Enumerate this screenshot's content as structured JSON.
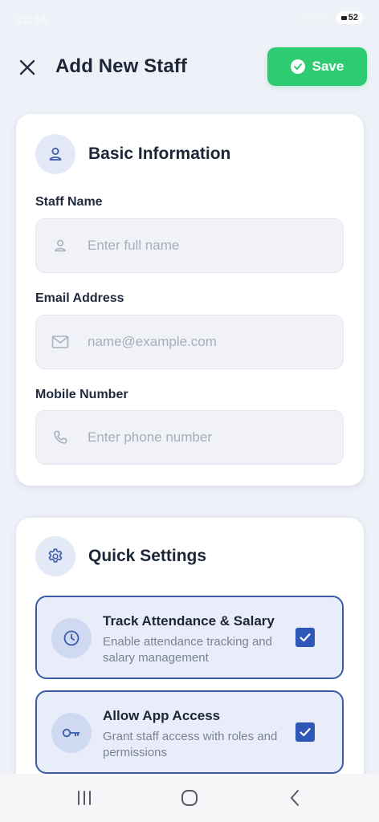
{
  "status_bar": {
    "time": "22:16",
    "signal": "Vo LTE",
    "battery": "52"
  },
  "header": {
    "title": "Add New Staff",
    "save_label": "Save"
  },
  "basic_info": {
    "title": "Basic Information",
    "fields": [
      {
        "label": "Staff Name",
        "placeholder": "Enter full name",
        "value": "",
        "icon": "user-icon"
      },
      {
        "label": "Email Address",
        "placeholder": "name@example.com",
        "value": "",
        "icon": "mail-icon"
      },
      {
        "label": "Mobile Number",
        "placeholder": "Enter phone number",
        "value": "",
        "icon": "phone-icon"
      }
    ]
  },
  "quick_settings": {
    "title": "Quick Settings",
    "options": [
      {
        "title": "Track Attendance & Salary",
        "description": "Enable attendance tracking and salary management",
        "checked": true,
        "icon": "clock-icon"
      },
      {
        "title": "Allow App Access",
        "description": "Grant staff access with roles and permissions",
        "checked": true,
        "icon": "key-icon"
      }
    ]
  },
  "colors": {
    "accent": "#2f57b8",
    "save_green": "#2ecc71",
    "background": "#eef1f8",
    "option_bg": "#e8edf9"
  }
}
